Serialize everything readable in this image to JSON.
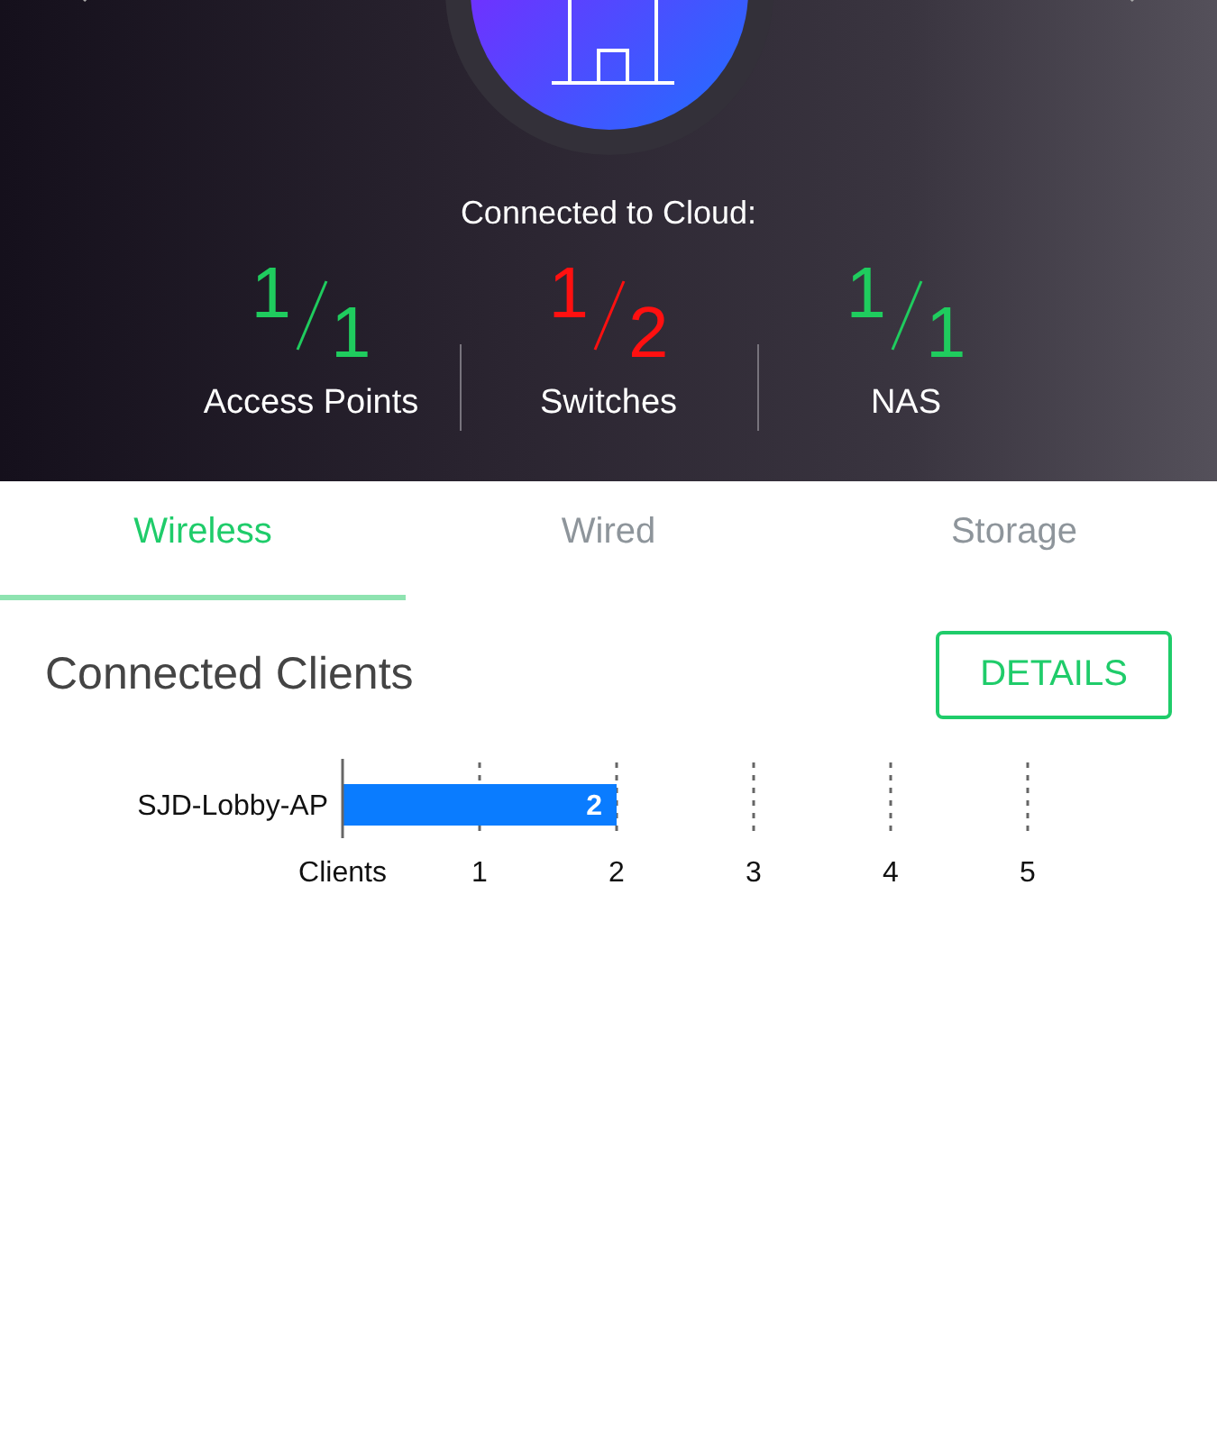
{
  "header": {
    "caption": "Connected to Cloud:",
    "stats": [
      {
        "online": "1",
        "total": "1",
        "label": "Access Points",
        "color": "#1fcc5e"
      },
      {
        "online": "1",
        "total": "2",
        "label": "Switches",
        "color": "#ff1010"
      },
      {
        "online": "1",
        "total": "1",
        "label": "NAS",
        "color": "#1fcc5e"
      }
    ]
  },
  "tabs": [
    {
      "label": "Wireless",
      "selected": true
    },
    {
      "label": "Wired",
      "selected": false
    },
    {
      "label": "Storage",
      "selected": false
    }
  ],
  "section": {
    "title": "Connected Clients",
    "button": "DETAILS",
    "chart_data": {
      "type": "bar",
      "orientation": "horizontal",
      "categories": [
        "SJD-Lobby-AP"
      ],
      "values": [
        2
      ],
      "xlabel": "Clients",
      "xlim": [
        0,
        5
      ],
      "xticks": [
        1,
        2,
        3,
        4,
        5
      ],
      "data_labels": true
    }
  }
}
